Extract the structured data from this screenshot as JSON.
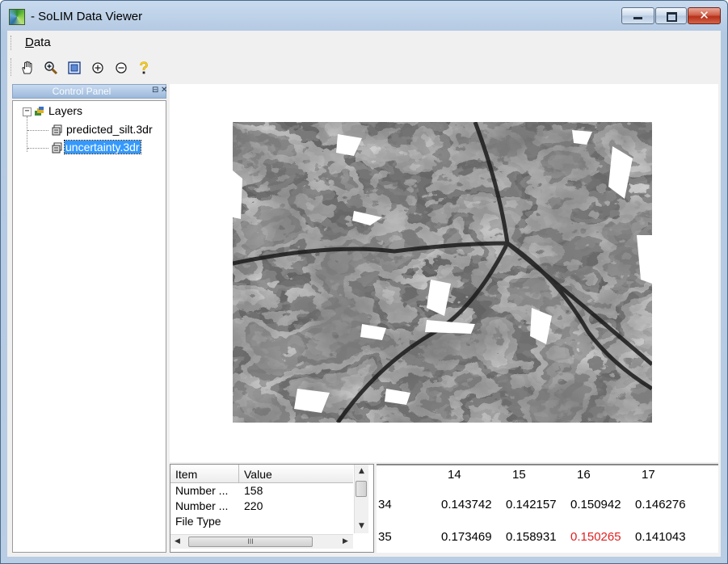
{
  "window": {
    "title": "- SoLIM Data Viewer",
    "controls": {
      "minimize": "minimize",
      "maximize": "maximize",
      "close": "close"
    }
  },
  "menu": {
    "items": [
      {
        "label": "Data",
        "accel": "D"
      }
    ]
  },
  "toolbar": {
    "buttons": [
      {
        "icon": "pan-hand-icon",
        "tooltip": ""
      },
      {
        "icon": "zoom-in-icon",
        "tooltip": ""
      },
      {
        "icon": "full-extent-icon",
        "tooltip": ""
      },
      {
        "icon": "zoom-in-plus-icon",
        "tooltip": ""
      },
      {
        "icon": "zoom-out-minus-icon",
        "tooltip": ""
      },
      {
        "icon": "identify-question-icon",
        "tooltip": ""
      }
    ]
  },
  "control_panel": {
    "title": "Control Panel",
    "tree": {
      "root": "Layers",
      "layers": [
        {
          "name": "predicted_silt.3dr",
          "selected": false
        },
        {
          "name": "uncertainty.3dr",
          "selected": true
        }
      ]
    }
  },
  "properties": {
    "headers": {
      "item": "Item",
      "value": "Value"
    },
    "rows": [
      {
        "item": "Number ...",
        "value": "158"
      },
      {
        "item": "Number ...",
        "value": "220"
      },
      {
        "item": "File Type",
        "value": ""
      }
    ],
    "hscroll_thumb": "III"
  },
  "value_grid": {
    "columns": [
      "14",
      "15",
      "16",
      "17"
    ],
    "rows": [
      {
        "label": "34",
        "values": [
          "0.143742",
          "0.142157",
          "0.150942",
          "0.146276"
        ]
      },
      {
        "label": "35",
        "values": [
          "0.173469",
          "0.158931",
          "0.150265",
          "0.141043"
        ],
        "highlight_index": 2
      }
    ],
    "highlight_color": "#e02020"
  }
}
